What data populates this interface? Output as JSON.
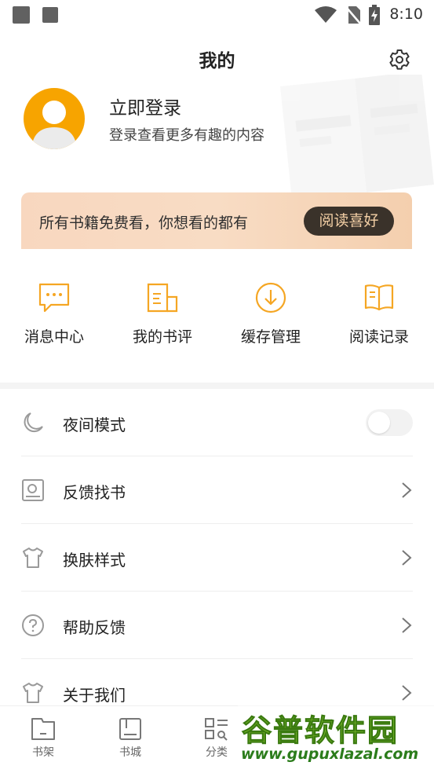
{
  "status_bar": {
    "time": "8:10"
  },
  "header": {
    "title": "我的"
  },
  "profile": {
    "login_title": "立即登录",
    "login_subtitle": "登录查看更多有趣的内容"
  },
  "banner": {
    "text": "所有书籍免费看，你想看的都有",
    "button": "阅读喜好"
  },
  "quick_actions": [
    {
      "label": "消息中心",
      "icon": "message-icon"
    },
    {
      "label": "我的书评",
      "icon": "book-review-icon"
    },
    {
      "label": "缓存管理",
      "icon": "download-icon"
    },
    {
      "label": "阅读记录",
      "icon": "open-book-icon"
    }
  ],
  "settings": [
    {
      "label": "夜间模式",
      "icon": "moon-icon",
      "toggle_on": false
    },
    {
      "label": "反馈找书",
      "icon": "search-book-icon"
    },
    {
      "label": "换肤样式",
      "icon": "shirt-icon"
    },
    {
      "label": "帮助反馈",
      "icon": "help-icon"
    },
    {
      "label": "关于我们",
      "icon": "shirt-icon"
    }
  ],
  "tabs": [
    {
      "label": "书架",
      "icon": "bookshelf-icon"
    },
    {
      "label": "书城",
      "icon": "bookstore-icon"
    },
    {
      "label": "分类",
      "icon": "category-icon"
    }
  ],
  "watermark": {
    "main": "谷普软件园",
    "url": "www.gupuxlazal.com"
  },
  "colors": {
    "accent": "#f7a400",
    "banner_button_bg": "#3a322a",
    "banner_button_text": "#f3cfa5"
  }
}
